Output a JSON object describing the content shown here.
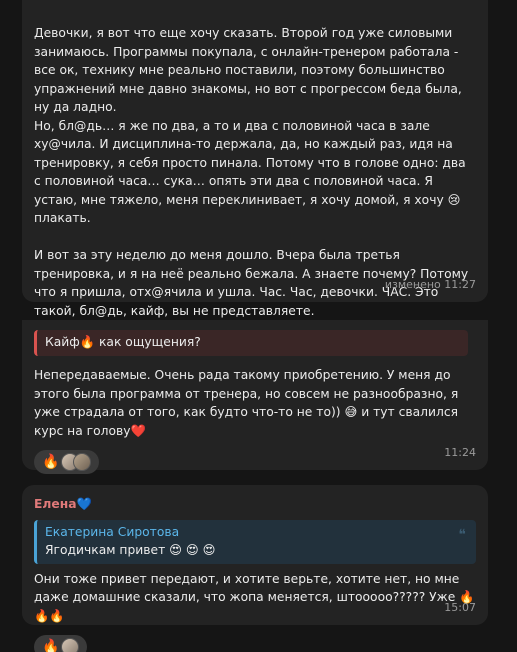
{
  "messages": [
    {
      "text": "Девочки, я вот что еще хочу сказать. Второй год уже силовыми занимаюсь. Программы покупала, с онлайн-тренером работала - все ок, технику мне реально поставили, поэтому большинство упражнений мне давно знакомы, но вот с прогрессом беда была, ну да ладно.\nНо, бл@дь… я же по два, а то и два с половиной часа в зале ху@чила. И дисциплина-то держала, да, но каждый раз, идя на тренировку, я себя просто пинала. Потому что в голове одно: два с половиной часа… сука… опять эти два с половиной часа. Я устаю, мне тяжело, меня переклинивает, я хочу домой, я хочу 😢 плакать.\n\nИ вот за эту неделю до меня дошло. Вчера была третья тренировка, и я на неё реально бежала. А знаете почему? Потому что я пришла, отх@ячила и ушла. Час. Час, девочки. ЧАС. Это такой, бл@дь, кайф, вы не представляете.",
      "reactions": [
        "🔥",
        "🤝",
        "🤣"
      ],
      "meta": "изменено 11:27"
    },
    {
      "reply_text": "Кайф🔥 как ощущения?",
      "text": "Непередаваемые. Очень рада такому приобретению. У меня до этого была программа от тренера, но совсем не разнообразно, я уже страдала от того, как будто что-то не то)) 😅 и тут свалился курс на голову",
      "heart": "❤️",
      "reactions": [
        "🔥"
      ],
      "meta": "11:24"
    },
    {
      "sender": "Елена💙",
      "quote_author": "Екатерина Сиротова",
      "quote_text": "Ягодичкам привет 😍 😍 😍",
      "text": "Они тоже привет передают, и хотите верьте, хотите нет, но мне даже домашние сказали, что жопа меняется, штооооо????? Уже 🔥🔥🔥",
      "reactions": [
        "🔥"
      ],
      "meta": "15:07"
    }
  ]
}
